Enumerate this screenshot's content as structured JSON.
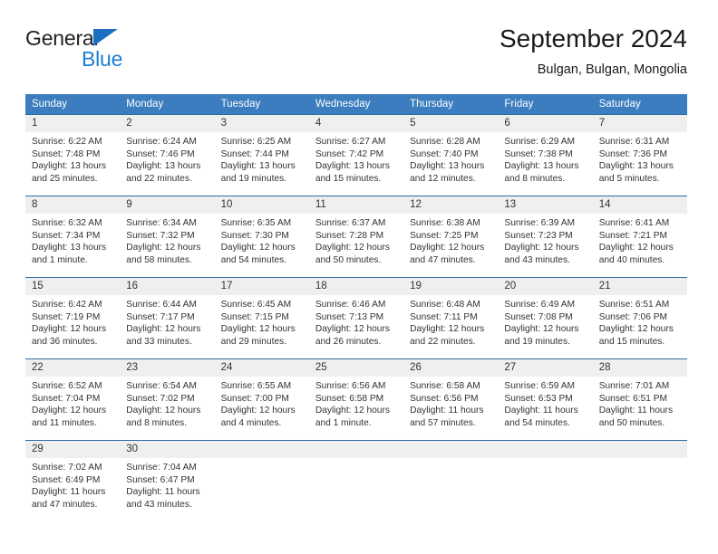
{
  "brand": {
    "name_top": "General",
    "name_bottom": "Blue",
    "accent_color": "#1b7fd4",
    "triangle_color": "#1b6ec2"
  },
  "header": {
    "title": "September 2024",
    "subtitle": "Bulgan, Bulgan, Mongolia"
  },
  "theme": {
    "header_bg": "#3b7dbf",
    "header_text": "#ffffff",
    "row_border": "#2e6da4",
    "daynum_bg": "#efefef",
    "body_text": "#333333"
  },
  "weekdays": [
    "Sunday",
    "Monday",
    "Tuesday",
    "Wednesday",
    "Thursday",
    "Friday",
    "Saturday"
  ],
  "weeks": [
    [
      {
        "day": "1",
        "sunrise": "Sunrise: 6:22 AM",
        "sunset": "Sunset: 7:48 PM",
        "daylight1": "Daylight: 13 hours",
        "daylight2": "and 25 minutes."
      },
      {
        "day": "2",
        "sunrise": "Sunrise: 6:24 AM",
        "sunset": "Sunset: 7:46 PM",
        "daylight1": "Daylight: 13 hours",
        "daylight2": "and 22 minutes."
      },
      {
        "day": "3",
        "sunrise": "Sunrise: 6:25 AM",
        "sunset": "Sunset: 7:44 PM",
        "daylight1": "Daylight: 13 hours",
        "daylight2": "and 19 minutes."
      },
      {
        "day": "4",
        "sunrise": "Sunrise: 6:27 AM",
        "sunset": "Sunset: 7:42 PM",
        "daylight1": "Daylight: 13 hours",
        "daylight2": "and 15 minutes."
      },
      {
        "day": "5",
        "sunrise": "Sunrise: 6:28 AM",
        "sunset": "Sunset: 7:40 PM",
        "daylight1": "Daylight: 13 hours",
        "daylight2": "and 12 minutes."
      },
      {
        "day": "6",
        "sunrise": "Sunrise: 6:29 AM",
        "sunset": "Sunset: 7:38 PM",
        "daylight1": "Daylight: 13 hours",
        "daylight2": "and 8 minutes."
      },
      {
        "day": "7",
        "sunrise": "Sunrise: 6:31 AM",
        "sunset": "Sunset: 7:36 PM",
        "daylight1": "Daylight: 13 hours",
        "daylight2": "and 5 minutes."
      }
    ],
    [
      {
        "day": "8",
        "sunrise": "Sunrise: 6:32 AM",
        "sunset": "Sunset: 7:34 PM",
        "daylight1": "Daylight: 13 hours",
        "daylight2": "and 1 minute."
      },
      {
        "day": "9",
        "sunrise": "Sunrise: 6:34 AM",
        "sunset": "Sunset: 7:32 PM",
        "daylight1": "Daylight: 12 hours",
        "daylight2": "and 58 minutes."
      },
      {
        "day": "10",
        "sunrise": "Sunrise: 6:35 AM",
        "sunset": "Sunset: 7:30 PM",
        "daylight1": "Daylight: 12 hours",
        "daylight2": "and 54 minutes."
      },
      {
        "day": "11",
        "sunrise": "Sunrise: 6:37 AM",
        "sunset": "Sunset: 7:28 PM",
        "daylight1": "Daylight: 12 hours",
        "daylight2": "and 50 minutes."
      },
      {
        "day": "12",
        "sunrise": "Sunrise: 6:38 AM",
        "sunset": "Sunset: 7:25 PM",
        "daylight1": "Daylight: 12 hours",
        "daylight2": "and 47 minutes."
      },
      {
        "day": "13",
        "sunrise": "Sunrise: 6:39 AM",
        "sunset": "Sunset: 7:23 PM",
        "daylight1": "Daylight: 12 hours",
        "daylight2": "and 43 minutes."
      },
      {
        "day": "14",
        "sunrise": "Sunrise: 6:41 AM",
        "sunset": "Sunset: 7:21 PM",
        "daylight1": "Daylight: 12 hours",
        "daylight2": "and 40 minutes."
      }
    ],
    [
      {
        "day": "15",
        "sunrise": "Sunrise: 6:42 AM",
        "sunset": "Sunset: 7:19 PM",
        "daylight1": "Daylight: 12 hours",
        "daylight2": "and 36 minutes."
      },
      {
        "day": "16",
        "sunrise": "Sunrise: 6:44 AM",
        "sunset": "Sunset: 7:17 PM",
        "daylight1": "Daylight: 12 hours",
        "daylight2": "and 33 minutes."
      },
      {
        "day": "17",
        "sunrise": "Sunrise: 6:45 AM",
        "sunset": "Sunset: 7:15 PM",
        "daylight1": "Daylight: 12 hours",
        "daylight2": "and 29 minutes."
      },
      {
        "day": "18",
        "sunrise": "Sunrise: 6:46 AM",
        "sunset": "Sunset: 7:13 PM",
        "daylight1": "Daylight: 12 hours",
        "daylight2": "and 26 minutes."
      },
      {
        "day": "19",
        "sunrise": "Sunrise: 6:48 AM",
        "sunset": "Sunset: 7:11 PM",
        "daylight1": "Daylight: 12 hours",
        "daylight2": "and 22 minutes."
      },
      {
        "day": "20",
        "sunrise": "Sunrise: 6:49 AM",
        "sunset": "Sunset: 7:08 PM",
        "daylight1": "Daylight: 12 hours",
        "daylight2": "and 19 minutes."
      },
      {
        "day": "21",
        "sunrise": "Sunrise: 6:51 AM",
        "sunset": "Sunset: 7:06 PM",
        "daylight1": "Daylight: 12 hours",
        "daylight2": "and 15 minutes."
      }
    ],
    [
      {
        "day": "22",
        "sunrise": "Sunrise: 6:52 AM",
        "sunset": "Sunset: 7:04 PM",
        "daylight1": "Daylight: 12 hours",
        "daylight2": "and 11 minutes."
      },
      {
        "day": "23",
        "sunrise": "Sunrise: 6:54 AM",
        "sunset": "Sunset: 7:02 PM",
        "daylight1": "Daylight: 12 hours",
        "daylight2": "and 8 minutes."
      },
      {
        "day": "24",
        "sunrise": "Sunrise: 6:55 AM",
        "sunset": "Sunset: 7:00 PM",
        "daylight1": "Daylight: 12 hours",
        "daylight2": "and 4 minutes."
      },
      {
        "day": "25",
        "sunrise": "Sunrise: 6:56 AM",
        "sunset": "Sunset: 6:58 PM",
        "daylight1": "Daylight: 12 hours",
        "daylight2": "and 1 minute."
      },
      {
        "day": "26",
        "sunrise": "Sunrise: 6:58 AM",
        "sunset": "Sunset: 6:56 PM",
        "daylight1": "Daylight: 11 hours",
        "daylight2": "and 57 minutes."
      },
      {
        "day": "27",
        "sunrise": "Sunrise: 6:59 AM",
        "sunset": "Sunset: 6:53 PM",
        "daylight1": "Daylight: 11 hours",
        "daylight2": "and 54 minutes."
      },
      {
        "day": "28",
        "sunrise": "Sunrise: 7:01 AM",
        "sunset": "Sunset: 6:51 PM",
        "daylight1": "Daylight: 11 hours",
        "daylight2": "and 50 minutes."
      }
    ],
    [
      {
        "day": "29",
        "sunrise": "Sunrise: 7:02 AM",
        "sunset": "Sunset: 6:49 PM",
        "daylight1": "Daylight: 11 hours",
        "daylight2": "and 47 minutes."
      },
      {
        "day": "30",
        "sunrise": "Sunrise: 7:04 AM",
        "sunset": "Sunset: 6:47 PM",
        "daylight1": "Daylight: 11 hours",
        "daylight2": "and 43 minutes."
      },
      {
        "day": "",
        "sunrise": "",
        "sunset": "",
        "daylight1": "",
        "daylight2": ""
      },
      {
        "day": "",
        "sunrise": "",
        "sunset": "",
        "daylight1": "",
        "daylight2": ""
      },
      {
        "day": "",
        "sunrise": "",
        "sunset": "",
        "daylight1": "",
        "daylight2": ""
      },
      {
        "day": "",
        "sunrise": "",
        "sunset": "",
        "daylight1": "",
        "daylight2": ""
      },
      {
        "day": "",
        "sunrise": "",
        "sunset": "",
        "daylight1": "",
        "daylight2": ""
      }
    ]
  ]
}
